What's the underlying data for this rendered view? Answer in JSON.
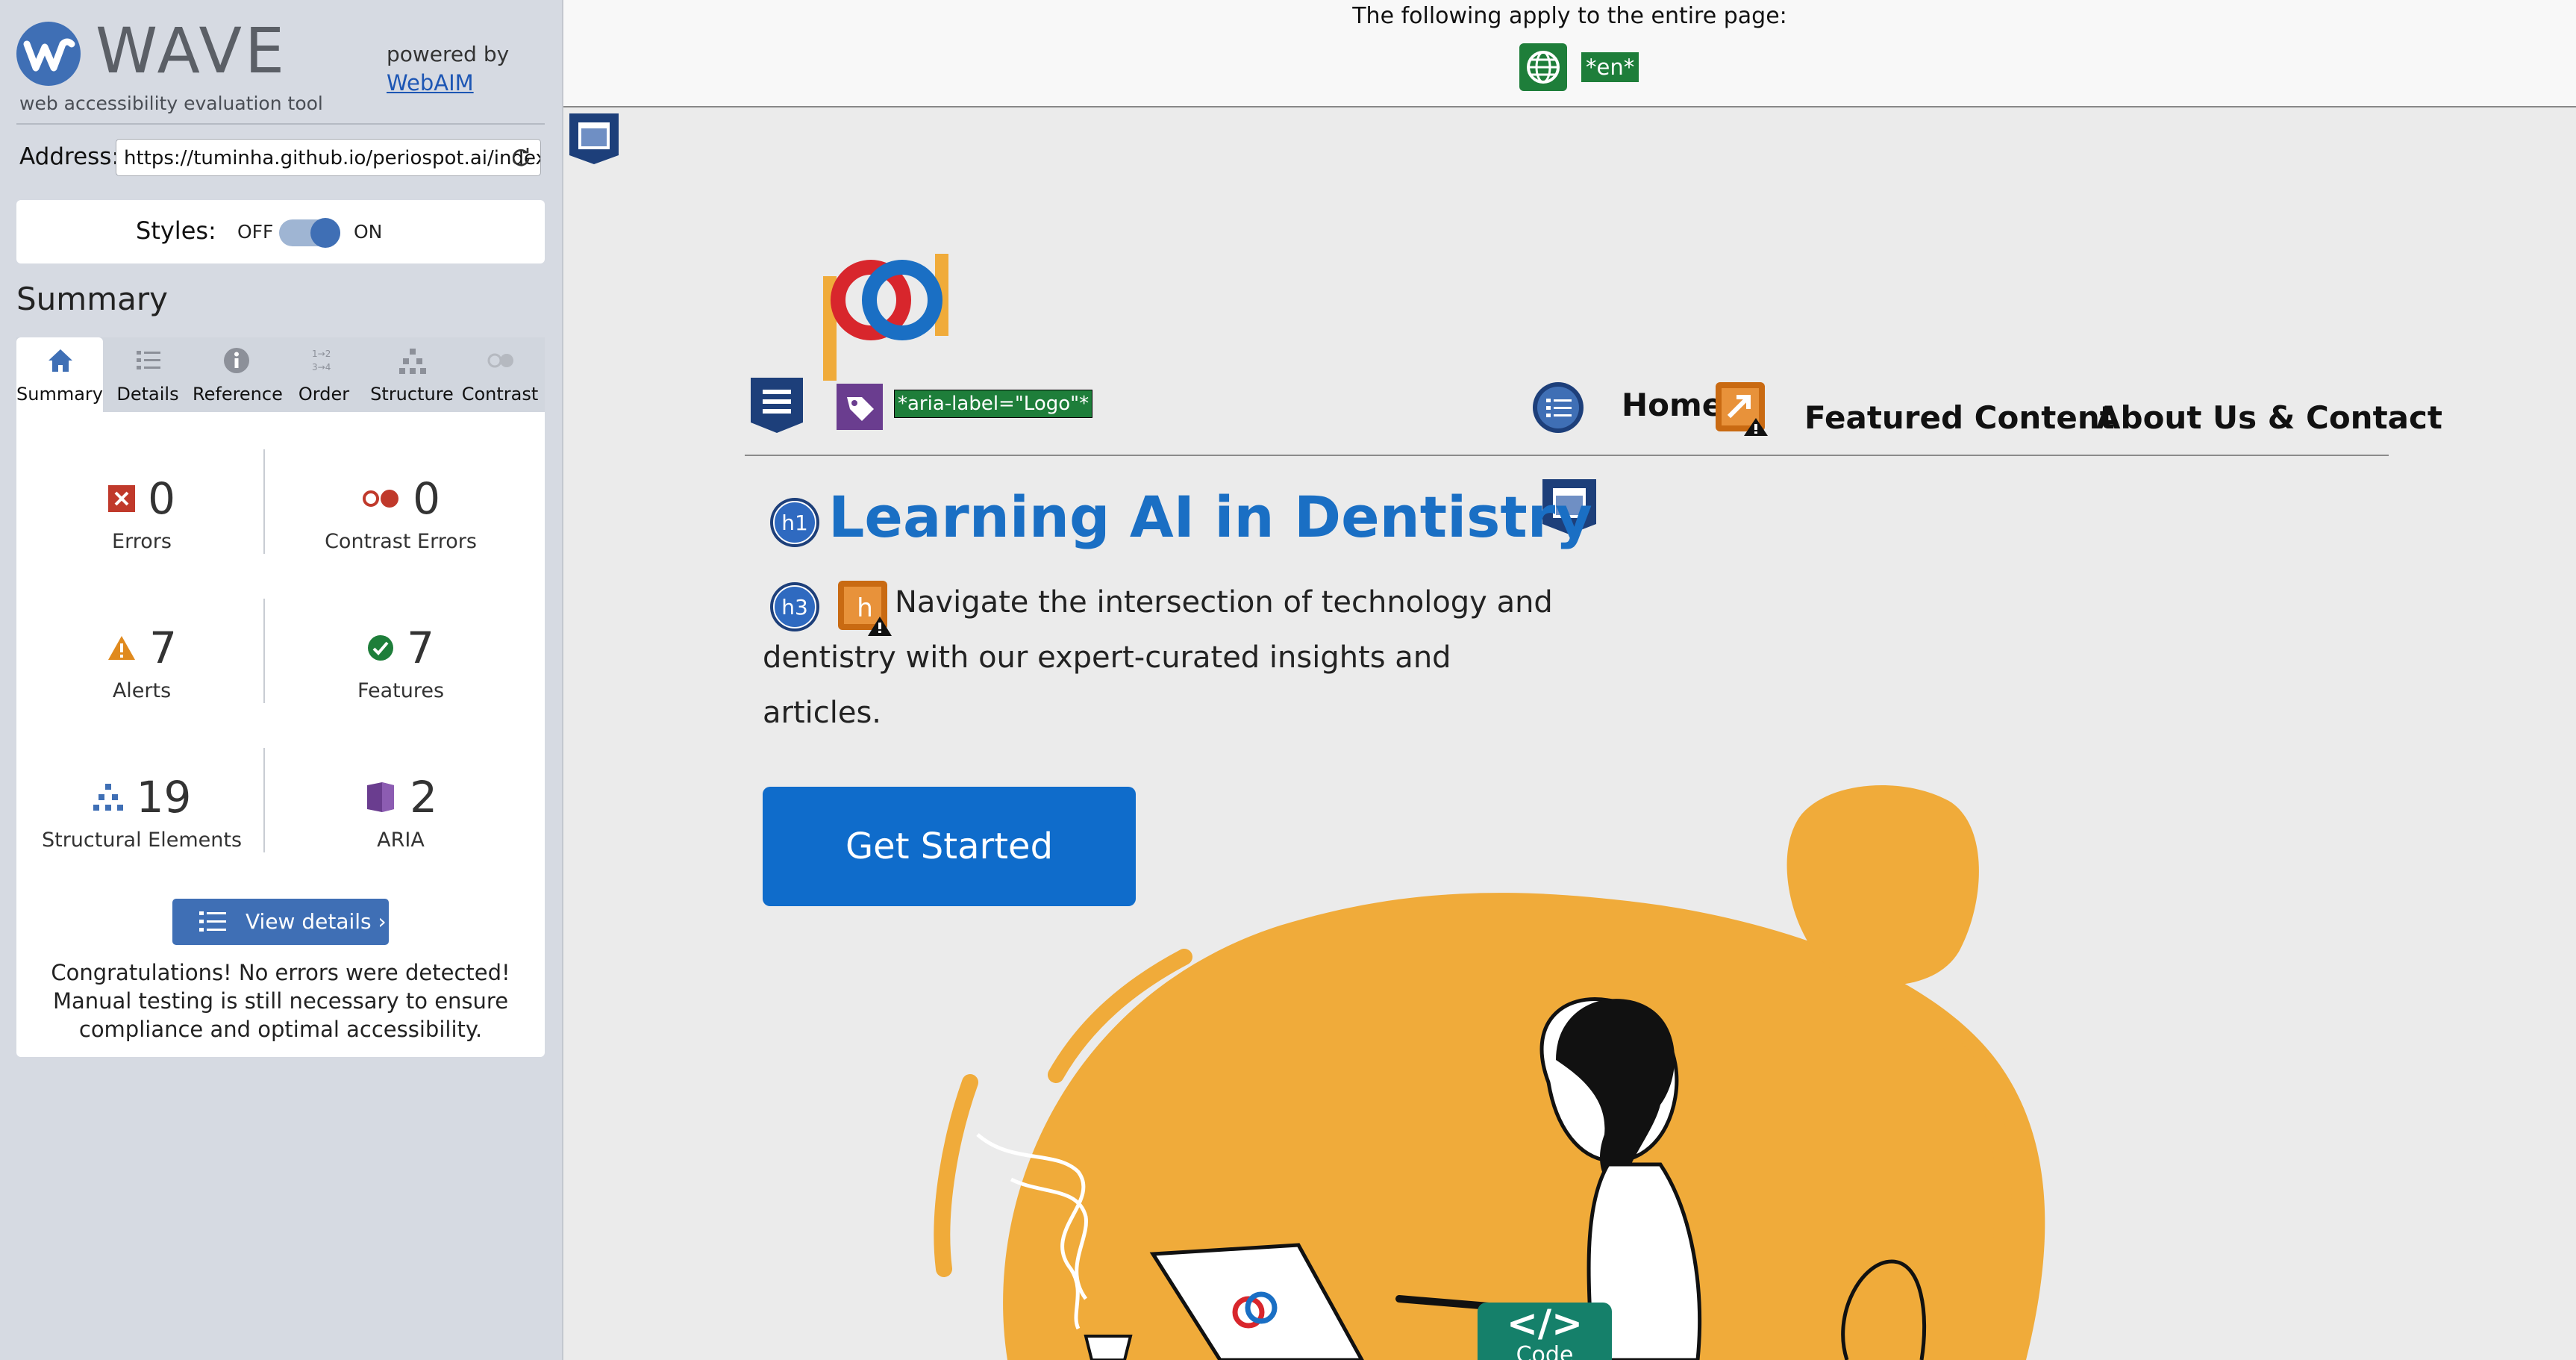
{
  "wave": {
    "title": "WAVE",
    "tagline": "web accessibility evaluation tool",
    "powered_by": "powered by",
    "powered_link": "WebAIM",
    "address_label": "Address:",
    "address_value": "https://tuminha.github.io/periospot.ai/index.",
    "styles_label": "Styles:",
    "styles_off": "OFF",
    "styles_on": "ON",
    "styles_state": "on",
    "summary_heading": "Summary",
    "tabs": [
      {
        "label": "Summary",
        "icon": "home-icon",
        "active": true
      },
      {
        "label": "Details",
        "icon": "list-icon",
        "active": false
      },
      {
        "label": "Reference",
        "icon": "info-icon",
        "active": false
      },
      {
        "label": "Order",
        "icon": "order-icon",
        "active": false
      },
      {
        "label": "Structure",
        "icon": "structure-icon",
        "active": false
      },
      {
        "label": "Contrast",
        "icon": "contrast-icon",
        "active": false
      }
    ],
    "metrics": {
      "errors": {
        "value": "0",
        "label": "Errors"
      },
      "contrast_errors": {
        "value": "0",
        "label": "Contrast Errors"
      },
      "alerts": {
        "value": "7",
        "label": "Alerts"
      },
      "features": {
        "value": "7",
        "label": "Features"
      },
      "structural": {
        "value": "19",
        "label": "Structural Elements"
      },
      "aria": {
        "value": "2",
        "label": "ARIA"
      }
    },
    "view_details": "View details ›",
    "congrats": "Congratulations! No errors were detected! Manual testing is still necessary to ensure compliance and optimal accessibility."
  },
  "preview": {
    "banner_text": "The following apply to the entire page:",
    "lang_badge": "*en*",
    "aria_label_tag": "*aria-label=\"Logo\"*",
    "nav": {
      "home": "Home",
      "featured": "Featured Content",
      "about": "About Us & Contact"
    },
    "h1_badge": "h1",
    "h3_badge": "h3",
    "hero_title": "Learning AI in Dentistry",
    "hero_sub": "Navigate the intersection of technology and dentistry with our expert-curated insights and articles.",
    "cta": "Get Started",
    "code_badge": "Code",
    "code_glyph": "</>"
  },
  "colors": {
    "wave_blue": "#3f6fb5",
    "feature_green": "#1e7e3a",
    "error_red": "#c0392b",
    "alert_orange": "#e08a1e",
    "aria_purple": "#6a3d8f",
    "site_blue": "#0f6ccb",
    "illustration_orange": "#f0ab3a",
    "code_teal": "#15806a"
  }
}
